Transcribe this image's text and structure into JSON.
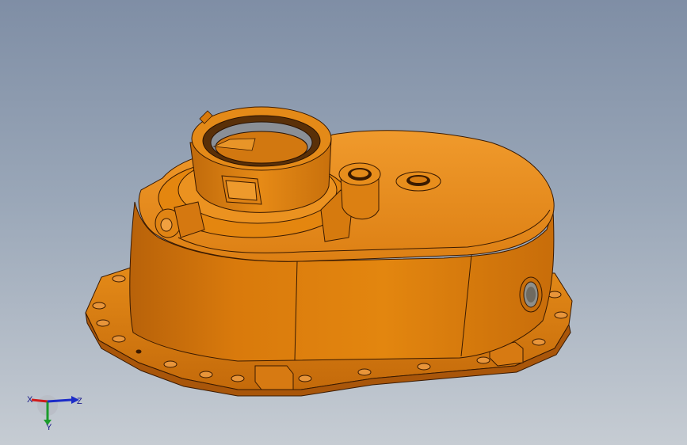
{
  "scene": {
    "background_top": "#7f8ea5",
    "background_bottom": "#c6ccd3",
    "part_color": "#d97a0c",
    "part_shadow": "#b8620a",
    "part_highlight": "#f09a2c"
  },
  "triad": {
    "x_label": "X",
    "y_label": "Y",
    "z_label": "Z",
    "x_color": "#d01c1c",
    "y_color": "#1c9c2c",
    "z_color": "#1c2cc8"
  }
}
